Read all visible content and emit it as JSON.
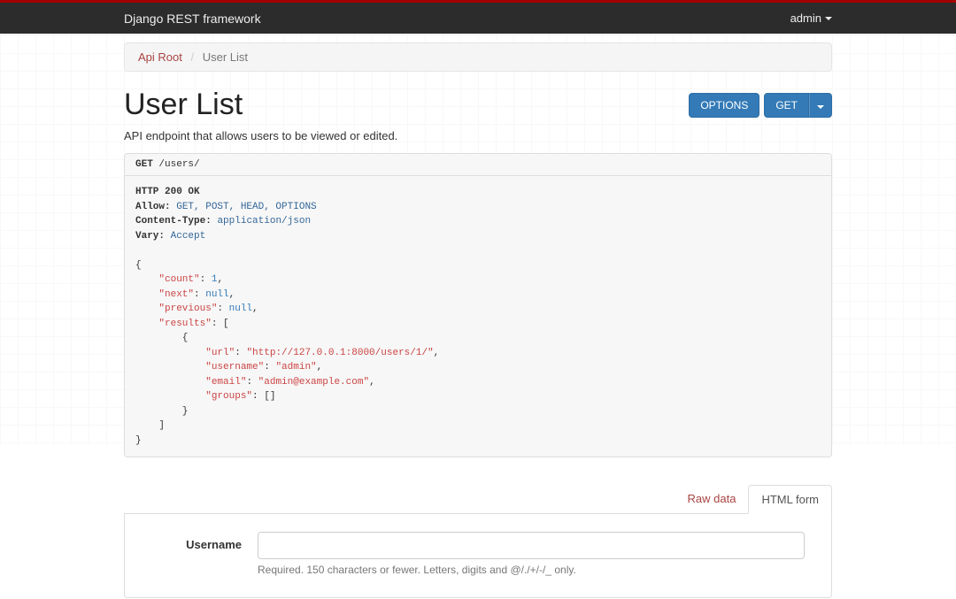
{
  "brand": "Django REST framework",
  "userMenu": "admin",
  "breadcrumb": {
    "root": "Api Root",
    "current": "User List"
  },
  "page": {
    "title": "User List",
    "desc": "API endpoint that allows users to be viewed or edited."
  },
  "buttons": {
    "options": "OPTIONS",
    "get": "GET"
  },
  "request": {
    "method": "GET",
    "path": "/users/"
  },
  "response": {
    "status": "HTTP 200 OK",
    "headers": {
      "allowLabel": "Allow:",
      "allow": "GET, POST, HEAD, OPTIONS",
      "ctLabel": "Content-Type:",
      "ct": "application/json",
      "varyLabel": "Vary:",
      "vary": "Accept"
    },
    "body": {
      "count": 1,
      "next": null,
      "previous": null,
      "results": [
        {
          "url": "http://127.0.0.1:8000/users/1/",
          "username": "admin",
          "email": "admin@example.com",
          "groups": []
        }
      ]
    }
  },
  "tabs": {
    "raw": "Raw data",
    "html": "HTML form"
  },
  "form": {
    "username": {
      "label": "Username",
      "help": "Required. 150 characters or fewer. Letters, digits and @/./+/-/_ only."
    }
  }
}
